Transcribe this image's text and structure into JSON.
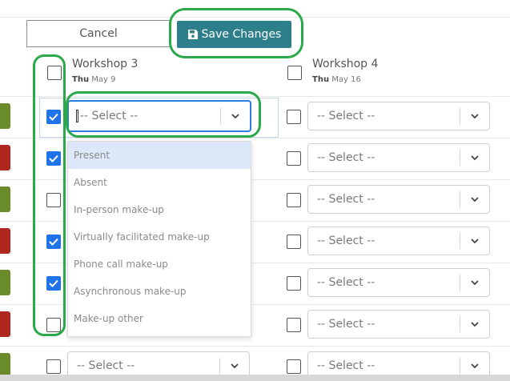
{
  "toolbar": {
    "cancel_label": "Cancel",
    "save_label": "Save Changes"
  },
  "columns": [
    {
      "title": "Workshop 3",
      "date_day": "Thu",
      "date_rest": "May 9"
    },
    {
      "title": "Workshop 4",
      "date_day": "Thu",
      "date_rest": "May 16"
    }
  ],
  "select_placeholder": "-- Select --",
  "dropdown_options": [
    "Present",
    "Absent",
    "In-person make-up",
    "Virtually facilitated make-up",
    "Phone call make-up",
    "Asynchronous make-up",
    "Make-up other"
  ],
  "workshop3_checked": [
    true,
    true,
    false,
    true,
    true,
    false,
    false
  ],
  "row_tag_colors": [
    "#6b8a2a",
    "#b0271f",
    "#6b8a2a",
    "#b0271f",
    "#6b8a2a",
    "#b0271f",
    "#6b8a2a"
  ],
  "colors": {
    "accent": "#2e7f8c",
    "checkbox": "#1f72e8",
    "highlight": "#2aa84a"
  },
  "icons": {
    "save": "floppy-disk-icon",
    "chevron": "chevron-down-icon"
  }
}
